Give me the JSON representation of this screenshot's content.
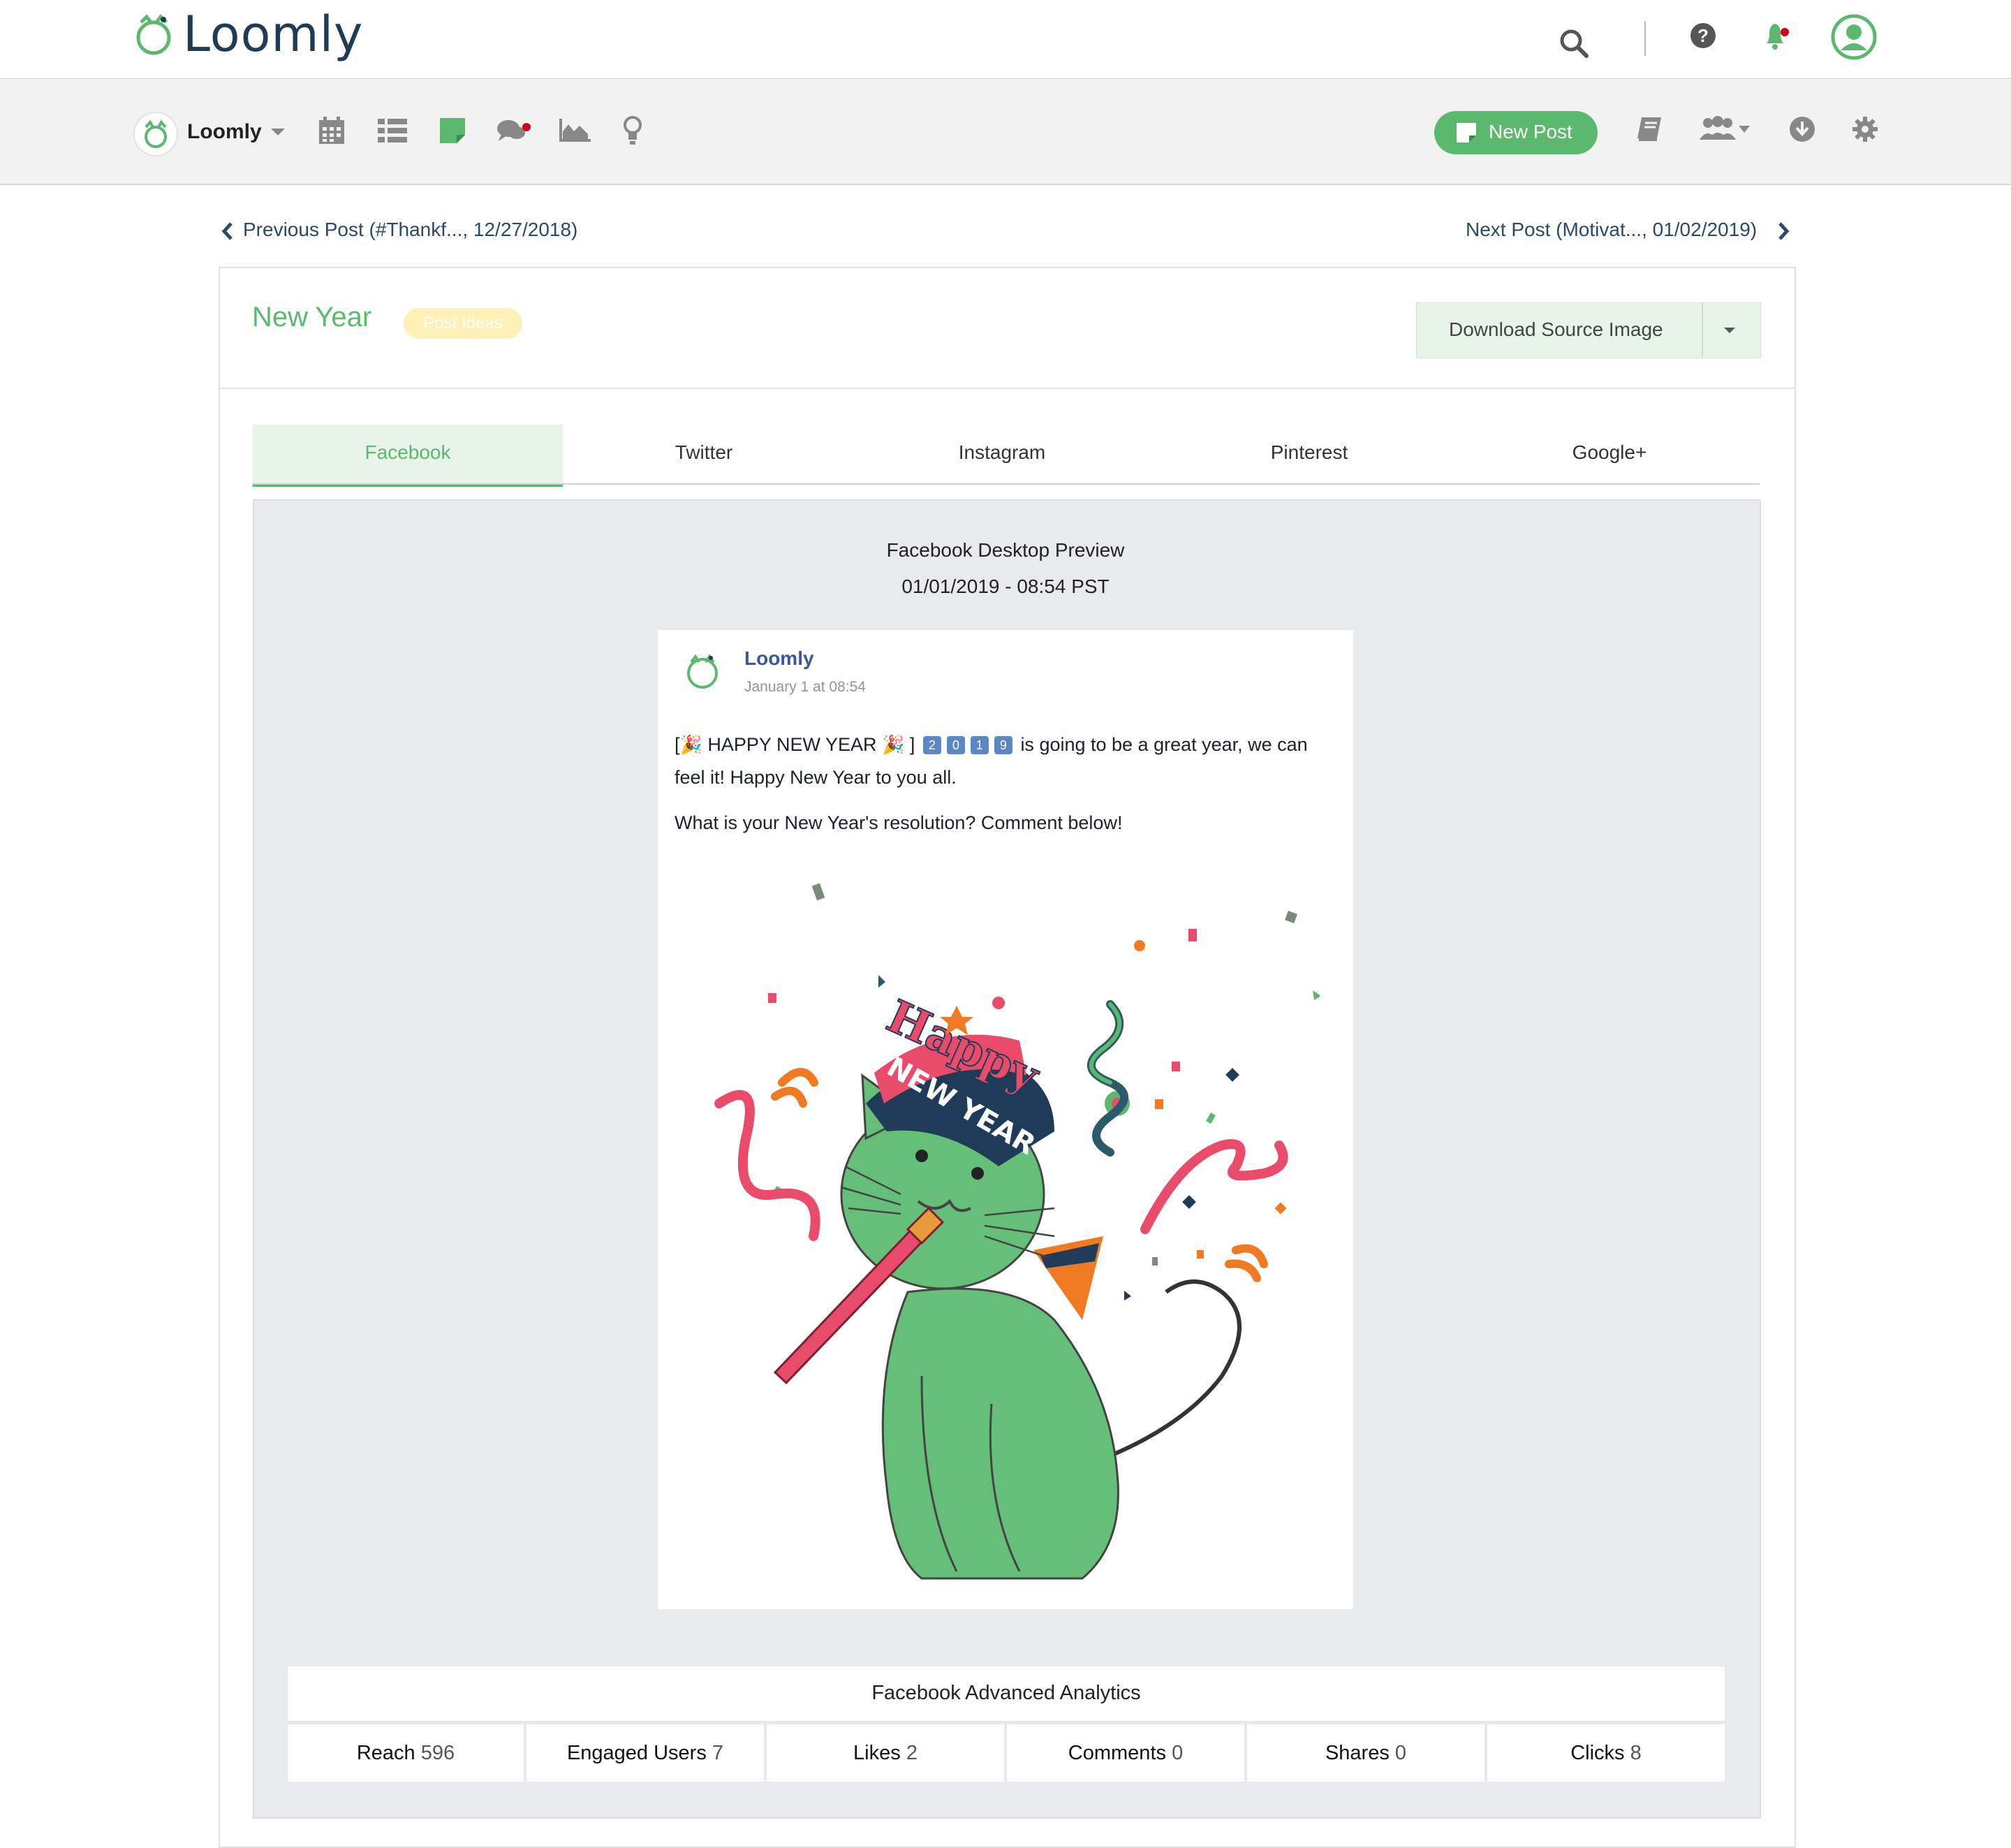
{
  "app": {
    "logo_text": "Loomly",
    "brand_name": "Loomly",
    "accent_color": "#5cb86f",
    "icons": [
      "search-icon",
      "help-icon",
      "bell-icon",
      "user-icon",
      "calendar-icon",
      "list-icon",
      "note-icon",
      "chat-icon",
      "analytics-icon",
      "bulb-icon",
      "book-icon",
      "team-icon",
      "download-icon",
      "gear-icon"
    ]
  },
  "toolbar": {
    "new_post_label": "New Post"
  },
  "nav": {
    "previous_label": "Previous Post (#Thankf..., 12/27/2018)",
    "next_label": "Next Post (Motivat..., 01/02/2019)"
  },
  "post": {
    "title": "New Year",
    "badge": "Post Ideas",
    "download_label": "Download Source Image"
  },
  "tabs": [
    {
      "label": "Facebook",
      "active": true
    },
    {
      "label": "Twitter",
      "active": false
    },
    {
      "label": "Instagram",
      "active": false
    },
    {
      "label": "Pinterest",
      "active": false
    },
    {
      "label": "Google+",
      "active": false
    }
  ],
  "preview": {
    "title": "Facebook Desktop Preview",
    "datetime": "01/01/2019 - 08:54 PST",
    "page_name": "Loomly",
    "post_time": "January 1 at 08:54",
    "text_prefix": "[",
    "text_happy": "HAPPY NEW YEAR",
    "text_bracket": "]",
    "digits": [
      "2",
      "0",
      "1",
      "9"
    ],
    "text_after_digits": "is going to be a great year, we can",
    "text_line2": "feel it! Happy New Year to you all.",
    "text_line3": "What is your New Year's resolution? Comment below!",
    "image_hat_top": "Happy",
    "image_hat_band": "NEW YEAR"
  },
  "analytics": {
    "title": "Facebook Advanced Analytics",
    "metrics": [
      {
        "label": "Reach",
        "value": "596"
      },
      {
        "label": "Engaged Users",
        "value": "7"
      },
      {
        "label": "Likes",
        "value": "2"
      },
      {
        "label": "Comments",
        "value": "0"
      },
      {
        "label": "Shares",
        "value": "0"
      },
      {
        "label": "Clicks",
        "value": "8"
      }
    ]
  }
}
